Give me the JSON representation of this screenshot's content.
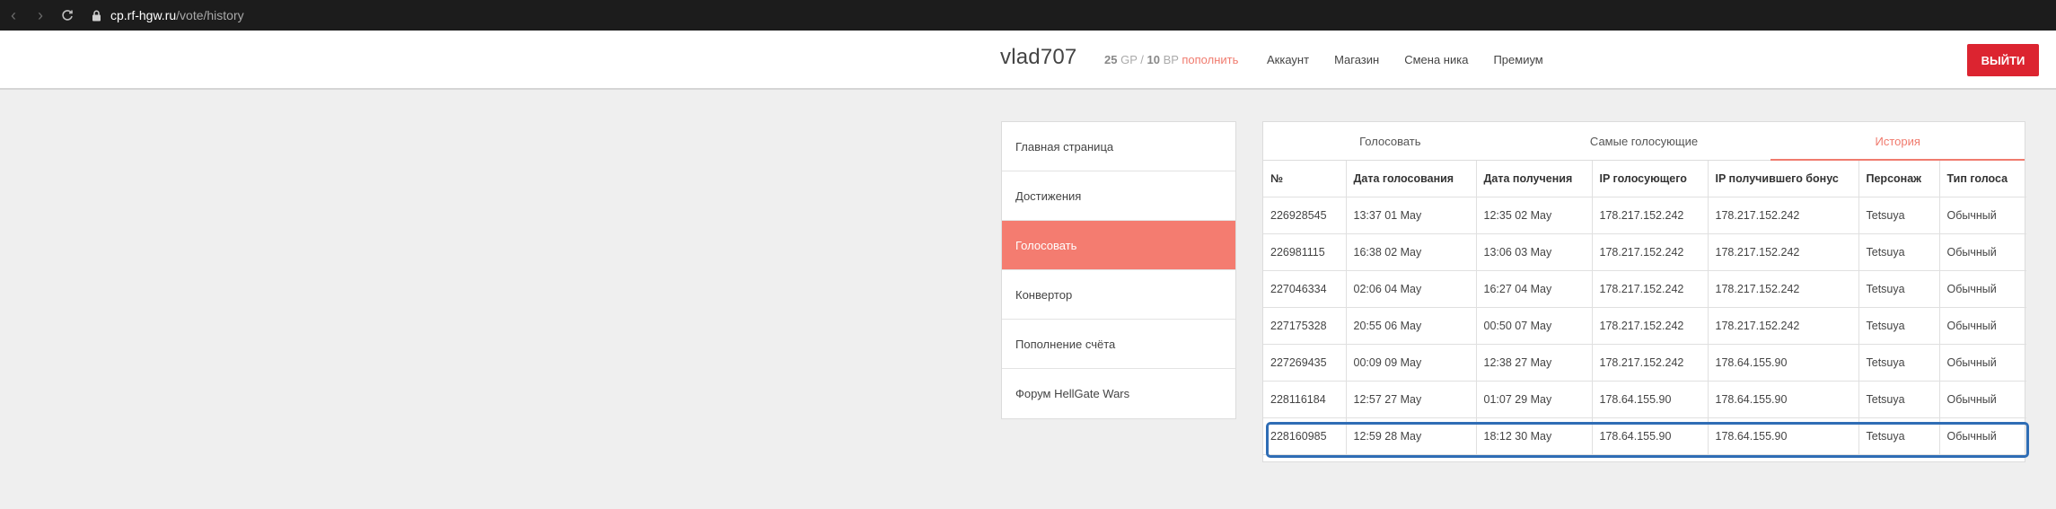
{
  "browser": {
    "url_host": "cp.rf-hgw.ru",
    "url_path": "/vote/history"
  },
  "header": {
    "username": "vlad707",
    "gp_amount": "25",
    "gp_label": "GP",
    "separator": "/",
    "bp_amount": "10",
    "bp_label": "BP",
    "topup_label": "пополнить",
    "nav": [
      "Аккаунт",
      "Магазин",
      "Смена ника",
      "Премиум"
    ],
    "logout_label": "ВЫЙТИ",
    "logout_color": "#dc2430"
  },
  "sidebar": {
    "items": [
      "Главная страница",
      "Достижения",
      "Голосовать",
      "Конвертор",
      "Пополнение счёта",
      "Форум HellGate Wars"
    ],
    "active_index": 2,
    "active_color": "#f47c70"
  },
  "tabs": {
    "items": [
      "Голосовать",
      "Самые голосующие",
      "История"
    ],
    "active_index": 2,
    "active_color": "#f07b6e"
  },
  "table": {
    "headers": [
      "№",
      "Дата голосования",
      "Дата получения",
      "IP голосующего",
      "IP получившего бонус",
      "Персонаж",
      "Тип голоса"
    ],
    "rows": [
      [
        "226928545",
        "13:37 01 May",
        "12:35 02 May",
        "178.217.152.242",
        "178.217.152.242",
        "Tetsuya",
        "Обычный"
      ],
      [
        "226981115",
        "16:38 02 May",
        "13:06 03 May",
        "178.217.152.242",
        "178.217.152.242",
        "Tetsuya",
        "Обычный"
      ],
      [
        "227046334",
        "02:06 04 May",
        "16:27 04 May",
        "178.217.152.242",
        "178.217.152.242",
        "Tetsuya",
        "Обычный"
      ],
      [
        "227175328",
        "20:55 06 May",
        "00:50 07 May",
        "178.217.152.242",
        "178.217.152.242",
        "Tetsuya",
        "Обычный"
      ],
      [
        "227269435",
        "00:09 09 May",
        "12:38 27 May",
        "178.217.152.242",
        "178.64.155.90",
        "Tetsuya",
        "Обычный"
      ],
      [
        "228116184",
        "12:57 27 May",
        "01:07 29 May",
        "178.64.155.90",
        "178.64.155.90",
        "Tetsuya",
        "Обычный"
      ],
      [
        "228160985",
        "12:59 28 May",
        "18:12 30 May",
        "178.64.155.90",
        "178.64.155.90",
        "Tetsuya",
        "Обычный"
      ]
    ],
    "highlighted_row_index": 6,
    "highlight_color": "#2f6db5"
  }
}
